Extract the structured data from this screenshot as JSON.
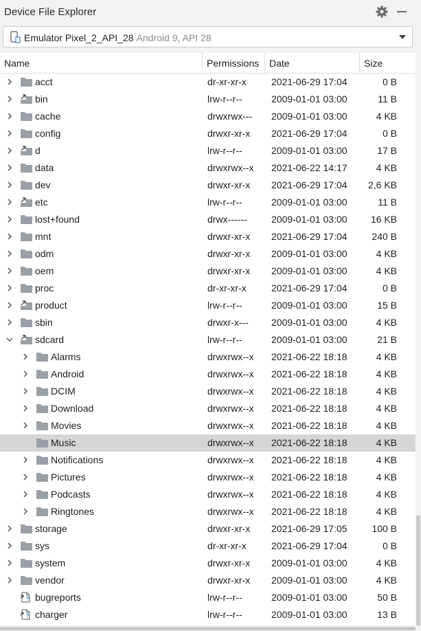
{
  "panel": {
    "title": "Device File Explorer"
  },
  "device": {
    "name": "Emulator Pixel_2_API_28",
    "details": "Android 9, API 28"
  },
  "columns": {
    "name": "Name",
    "permissions": "Permissions",
    "date": "Date",
    "size": "Size"
  },
  "rows": [
    {
      "name": "acct",
      "perm": "dr-xr-xr-x",
      "date": "2021-06-29 17:04",
      "size": "0 B",
      "level": 0,
      "type": "folder",
      "expand": "collapsed"
    },
    {
      "name": "bin",
      "perm": "lrw-r--r--",
      "date": "2009-01-01 03:00",
      "size": "11 B",
      "level": 0,
      "type": "link",
      "expand": "collapsed"
    },
    {
      "name": "cache",
      "perm": "drwxrwx---",
      "date": "2009-01-01 03:00",
      "size": "4 KB",
      "level": 0,
      "type": "folder",
      "expand": "collapsed"
    },
    {
      "name": "config",
      "perm": "drwxr-xr-x",
      "date": "2021-06-29 17:04",
      "size": "0 B",
      "level": 0,
      "type": "folder",
      "expand": "collapsed"
    },
    {
      "name": "d",
      "perm": "lrw-r--r--",
      "date": "2009-01-01 03:00",
      "size": "17 B",
      "level": 0,
      "type": "link",
      "expand": "collapsed"
    },
    {
      "name": "data",
      "perm": "drwxrwx--x",
      "date": "2021-06-22 14:17",
      "size": "4 KB",
      "level": 0,
      "type": "folder",
      "expand": "collapsed"
    },
    {
      "name": "dev",
      "perm": "drwxr-xr-x",
      "date": "2021-06-29 17:04",
      "size": "2,6 KB",
      "level": 0,
      "type": "folder",
      "expand": "collapsed"
    },
    {
      "name": "etc",
      "perm": "lrw-r--r--",
      "date": "2009-01-01 03:00",
      "size": "11 B",
      "level": 0,
      "type": "link",
      "expand": "collapsed"
    },
    {
      "name": "lost+found",
      "perm": "drwx------",
      "date": "2009-01-01 03:00",
      "size": "16 KB",
      "level": 0,
      "type": "folder",
      "expand": "collapsed"
    },
    {
      "name": "mnt",
      "perm": "drwxr-xr-x",
      "date": "2021-06-29 17:04",
      "size": "240 B",
      "level": 0,
      "type": "folder",
      "expand": "collapsed"
    },
    {
      "name": "odm",
      "perm": "drwxr-xr-x",
      "date": "2009-01-01 03:00",
      "size": "4 KB",
      "level": 0,
      "type": "folder",
      "expand": "collapsed"
    },
    {
      "name": "oem",
      "perm": "drwxr-xr-x",
      "date": "2009-01-01 03:00",
      "size": "4 KB",
      "level": 0,
      "type": "folder",
      "expand": "collapsed"
    },
    {
      "name": "proc",
      "perm": "dr-xr-xr-x",
      "date": "2021-06-29 17:04",
      "size": "0 B",
      "level": 0,
      "type": "folder",
      "expand": "collapsed"
    },
    {
      "name": "product",
      "perm": "lrw-r--r--",
      "date": "2009-01-01 03:00",
      "size": "15 B",
      "level": 0,
      "type": "link",
      "expand": "collapsed"
    },
    {
      "name": "sbin",
      "perm": "drwxr-x---",
      "date": "2009-01-01 03:00",
      "size": "4 KB",
      "level": 0,
      "type": "folder",
      "expand": "collapsed"
    },
    {
      "name": "sdcard",
      "perm": "lrw-r--r--",
      "date": "2009-01-01 03:00",
      "size": "21 B",
      "level": 0,
      "type": "link",
      "expand": "expanded"
    },
    {
      "name": "Alarms",
      "perm": "drwxrwx--x",
      "date": "2021-06-22 18:18",
      "size": "4 KB",
      "level": 1,
      "type": "folder",
      "expand": "collapsed"
    },
    {
      "name": "Android",
      "perm": "drwxrwx--x",
      "date": "2021-06-22 18:18",
      "size": "4 KB",
      "level": 1,
      "type": "folder",
      "expand": "collapsed"
    },
    {
      "name": "DCIM",
      "perm": "drwxrwx--x",
      "date": "2021-06-22 18:18",
      "size": "4 KB",
      "level": 1,
      "type": "folder",
      "expand": "collapsed"
    },
    {
      "name": "Download",
      "perm": "drwxrwx--x",
      "date": "2021-06-22 18:18",
      "size": "4 KB",
      "level": 1,
      "type": "folder",
      "expand": "collapsed"
    },
    {
      "name": "Movies",
      "perm": "drwxrwx--x",
      "date": "2021-06-22 18:18",
      "size": "4 KB",
      "level": 1,
      "type": "folder",
      "expand": "collapsed"
    },
    {
      "name": "Music",
      "perm": "drwxrwx--x",
      "date": "2021-06-22 18:18",
      "size": "4 KB",
      "level": 1,
      "type": "folder",
      "expand": "none",
      "selected": true
    },
    {
      "name": "Notifications",
      "perm": "drwxrwx--x",
      "date": "2021-06-22 18:18",
      "size": "4 KB",
      "level": 1,
      "type": "folder",
      "expand": "collapsed"
    },
    {
      "name": "Pictures",
      "perm": "drwxrwx--x",
      "date": "2021-06-22 18:18",
      "size": "4 KB",
      "level": 1,
      "type": "folder",
      "expand": "collapsed"
    },
    {
      "name": "Podcasts",
      "perm": "drwxrwx--x",
      "date": "2021-06-22 18:18",
      "size": "4 KB",
      "level": 1,
      "type": "folder",
      "expand": "collapsed"
    },
    {
      "name": "Ringtones",
      "perm": "drwxrwx--x",
      "date": "2021-06-22 18:18",
      "size": "4 KB",
      "level": 1,
      "type": "folder",
      "expand": "collapsed"
    },
    {
      "name": "storage",
      "perm": "drwxr-xr-x",
      "date": "2021-06-29 17:05",
      "size": "100 B",
      "level": 0,
      "type": "folder",
      "expand": "collapsed"
    },
    {
      "name": "sys",
      "perm": "dr-xr-xr-x",
      "date": "2021-06-29 17:04",
      "size": "0 B",
      "level": 0,
      "type": "folder",
      "expand": "collapsed"
    },
    {
      "name": "system",
      "perm": "drwxr-xr-x",
      "date": "2009-01-01 03:00",
      "size": "4 KB",
      "level": 0,
      "type": "folder",
      "expand": "collapsed"
    },
    {
      "name": "vendor",
      "perm": "drwxr-xr-x",
      "date": "2009-01-01 03:00",
      "size": "4 KB",
      "level": 0,
      "type": "folder",
      "expand": "collapsed"
    },
    {
      "name": "bugreports",
      "perm": "lrw-r--r--",
      "date": "2009-01-01 03:00",
      "size": "50 B",
      "level": 0,
      "type": "file-link",
      "expand": "none"
    },
    {
      "name": "charger",
      "perm": "lrw-r--r--",
      "date": "2009-01-01 03:00",
      "size": "13 B",
      "level": 0,
      "type": "file-link",
      "expand": "none"
    },
    {
      "name": "",
      "perm": "",
      "date": "",
      "size": "",
      "level": 0,
      "type": "file-link",
      "expand": "none"
    }
  ],
  "colors": {
    "folder": "#9aa0a6",
    "selected_row": "#d5d5d5",
    "link_arrow": "#4a4a4a",
    "file_link_badge": "#3d7fc1"
  }
}
